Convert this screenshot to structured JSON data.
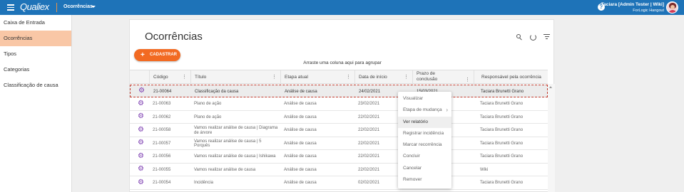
{
  "topbar": {
    "logo": "Qualiex",
    "module": "Ocorrências",
    "user_name": "Taciara [Admin Tester | Wiki]",
    "company": "ForLogic Hangout"
  },
  "sidebar": {
    "items": [
      {
        "label": "Caixa de Entrada",
        "active": false
      },
      {
        "label": "Ocorrências",
        "active": true
      },
      {
        "label": "Tipos",
        "active": false
      },
      {
        "label": "Categorias",
        "active": false
      },
      {
        "label": "Classificação de causa",
        "active": false
      }
    ]
  },
  "page": {
    "title": "Ocorrências",
    "add_button": "CADASTRAR",
    "group_hint": "Arraste uma coluna aqui para agrupar"
  },
  "table": {
    "columns": [
      "Código",
      "Título",
      "Etapa atual",
      "Data de início",
      "Prazo de conclusão",
      "Responsável pela ocorrência"
    ],
    "rows": [
      {
        "code": "21-00064",
        "title": "Classificação da causa",
        "stage": "Análise de causa",
        "start": "24/02/2021",
        "deadline": "15/03/2021",
        "owner": "Taciara Brunetti Grano",
        "selected": true
      },
      {
        "code": "21-00063",
        "title": "Plano de ação",
        "stage": "Análise de causa",
        "start": "23/02/2021",
        "deadline": "",
        "owner": "Taciara Brunetti Grano",
        "selected": false
      },
      {
        "code": "21-00062",
        "title": "Plano de ação",
        "stage": "Análise de causa",
        "start": "22/02/2021",
        "deadline": "",
        "owner": "Taciara Brunetti Grano",
        "selected": false
      },
      {
        "code": "21-00058",
        "title": "Vamos realizar análise de causa | Diagrama de árvore",
        "stage": "Análise de causa",
        "start": "22/02/2021",
        "deadline": "",
        "owner": "Taciara Brunetti Grano",
        "selected": false
      },
      {
        "code": "21-00057",
        "title": "Vamos realizar análise de causa | 5 Porquês",
        "stage": "Análise de causa",
        "start": "22/02/2021",
        "deadline": "",
        "owner": "Taciara Brunetti Grano",
        "selected": false
      },
      {
        "code": "21-00056",
        "title": "Vamos realizar análise de causa | Ishikawa",
        "stage": "Análise de causa",
        "start": "22/02/2021",
        "deadline": "",
        "owner": "Taciara Brunetti Grano",
        "selected": false
      },
      {
        "code": "21-00055",
        "title": "Vamos realizar análise de causa",
        "stage": "Análise de causa",
        "start": "22/02/2021",
        "deadline": "",
        "owner": "Wiki",
        "selected": false
      },
      {
        "code": "21-00054",
        "title": "Incidência",
        "stage": "Análise de causa",
        "start": "02/02/2021",
        "deadline": "",
        "owner": "Taciara Brunetti Grano",
        "selected": false
      }
    ]
  },
  "context_menu": {
    "items": [
      {
        "label": "Visualizar",
        "submenu": false,
        "hover": false
      },
      {
        "label": "Etapa de mudança",
        "submenu": true,
        "hover": false
      },
      {
        "label": "Ver relatório",
        "submenu": false,
        "hover": true
      },
      {
        "label": "Registrar incidência",
        "submenu": false,
        "hover": false
      },
      {
        "label": "Marcar recorrência",
        "submenu": false,
        "hover": false
      },
      {
        "label": "Concluir",
        "submenu": false,
        "hover": false
      },
      {
        "label": "Cancelar",
        "submenu": false,
        "hover": false
      },
      {
        "label": "Remover",
        "submenu": false,
        "hover": false
      }
    ]
  },
  "colors": {
    "topbar": "#1e73b8",
    "accent": "#f26a22",
    "sidebar_active": "#f9c7a6",
    "gear": "#7b3bb0"
  },
  "icons": [
    "menu-icon",
    "chevron-down-icon",
    "help-icon",
    "search-icon",
    "refresh-icon",
    "filter-icon",
    "plus-icon",
    "gear-icon",
    "column-menu-icon",
    "chevron-right-icon"
  ]
}
